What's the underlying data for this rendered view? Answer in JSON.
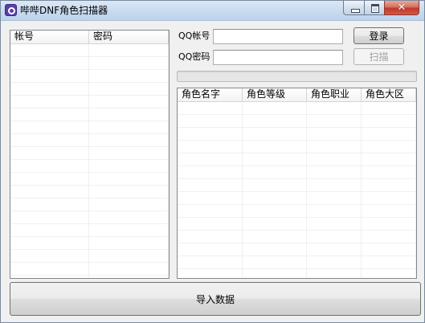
{
  "window": {
    "title": "哔哔DNF角色扫描器"
  },
  "account_list": {
    "columns": [
      "帐号",
      "密码"
    ],
    "rows": []
  },
  "login": {
    "qq_account_label": "QQ帐号",
    "qq_account_value": "",
    "qq_password_label": "QQ密码",
    "qq_password_value": "",
    "login_button": "登录",
    "scan_button": "扫描"
  },
  "progress": {
    "value": 0
  },
  "role_list": {
    "columns": [
      "角色名字",
      "角色等级",
      "角色职业",
      "角色大区"
    ],
    "rows": []
  },
  "import_button": "导入数据",
  "colors": {
    "progress_fill": "#06b025",
    "close_button": "#c0392b"
  }
}
